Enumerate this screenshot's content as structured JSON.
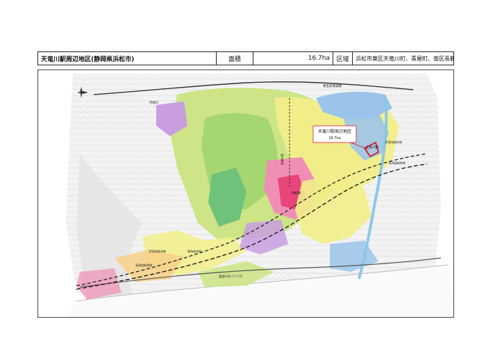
{
  "header": {
    "title": "天竜川駅周辺地区(静岡県浜松市)",
    "area_label": "面積",
    "area_value": "16.7ha",
    "region_label": "区域",
    "region_value": "浜松市東区天竜川町、青屋町、南区長鶴町の一部"
  },
  "map": {
    "callout_title": "天竜川駅周辺地区",
    "callout_area": "16.7ha",
    "labels": {
      "expressway": "東名高速道路",
      "tenryugawa_station": "天竜川駅",
      "hamamatsu_station": "浜松駅",
      "tokaido_line": "JR東海道本線",
      "shinkansen": "東海道新幹線",
      "bypass": "国道1号バイパス",
      "enshu_line": "遠州鉄道",
      "interchange": "浜松IC",
      "line_left_1": "JR東海道本線",
      "line_left_2": "東海道新幹線",
      "line_bottom": "東海道本線"
    },
    "colors": {
      "residential_yellow": "#f2ee8a",
      "residential_green": "#c9e37a",
      "commercial_pink": "#f08fb5",
      "commercial_red": "#e8457a",
      "industrial_blue": "#9cc4ea",
      "industrial_purple": "#c89ee0",
      "park_green": "#6fc27a",
      "target_outline": "#e0142d"
    }
  }
}
